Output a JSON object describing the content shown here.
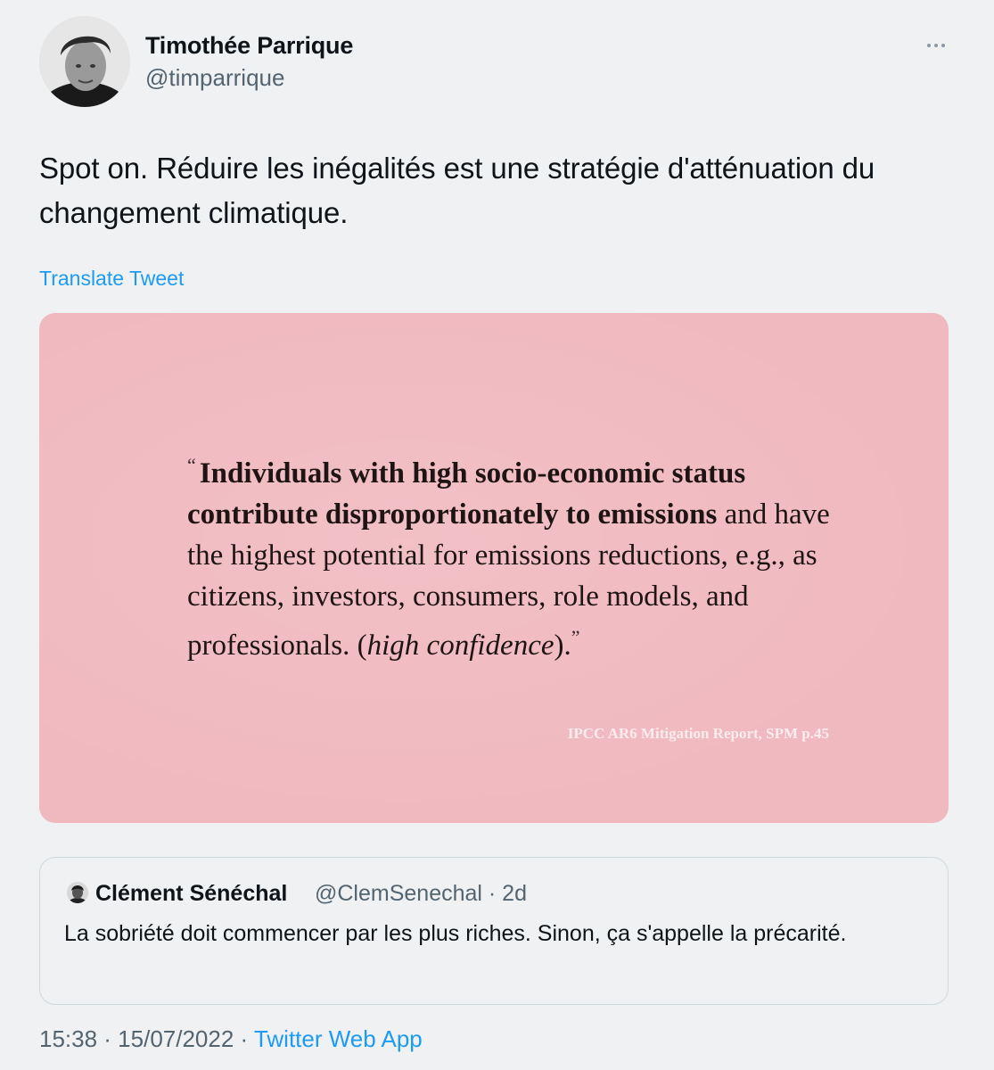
{
  "author": {
    "name": "Timothée Parrique",
    "handle": "@timparrique"
  },
  "tweet": {
    "text": "Spot on. Réduire les inégalités est une stratégie d'atténuation du changement climatique.",
    "translate_label": "Translate Tweet"
  },
  "media": {
    "quote_open": "“",
    "quote_bold": "Individuals with high socio-economic status contribute disproportionately to emissions",
    "quote_rest": " and have the highest potential for emissions reductions, e.g., as citizens, investors, consumers, role models, and professionals. (",
    "quote_italic": "high confidence",
    "quote_end": ").",
    "quote_close": "”",
    "source": "IPCC AR6 Mitigation Report, SPM p.45",
    "background_color": "#f0b9bf"
  },
  "quoted_tweet": {
    "name": "Clément Sénéchal",
    "handle_time": "@ClemSenechal · 2d",
    "text": "La sobriété doit commencer par les plus riches. Sinon, ça s'appelle la précarité."
  },
  "meta": {
    "time_date": "15:38 · 15/07/2022 · ",
    "source": "Twitter Web App"
  },
  "icons": {
    "more": "more-icon",
    "avatar": "avatar",
    "quoted_avatar": "avatar"
  },
  "colors": {
    "link": "#1d9bf0",
    "secondary_text": "#536471",
    "background": "#eff1f3"
  }
}
